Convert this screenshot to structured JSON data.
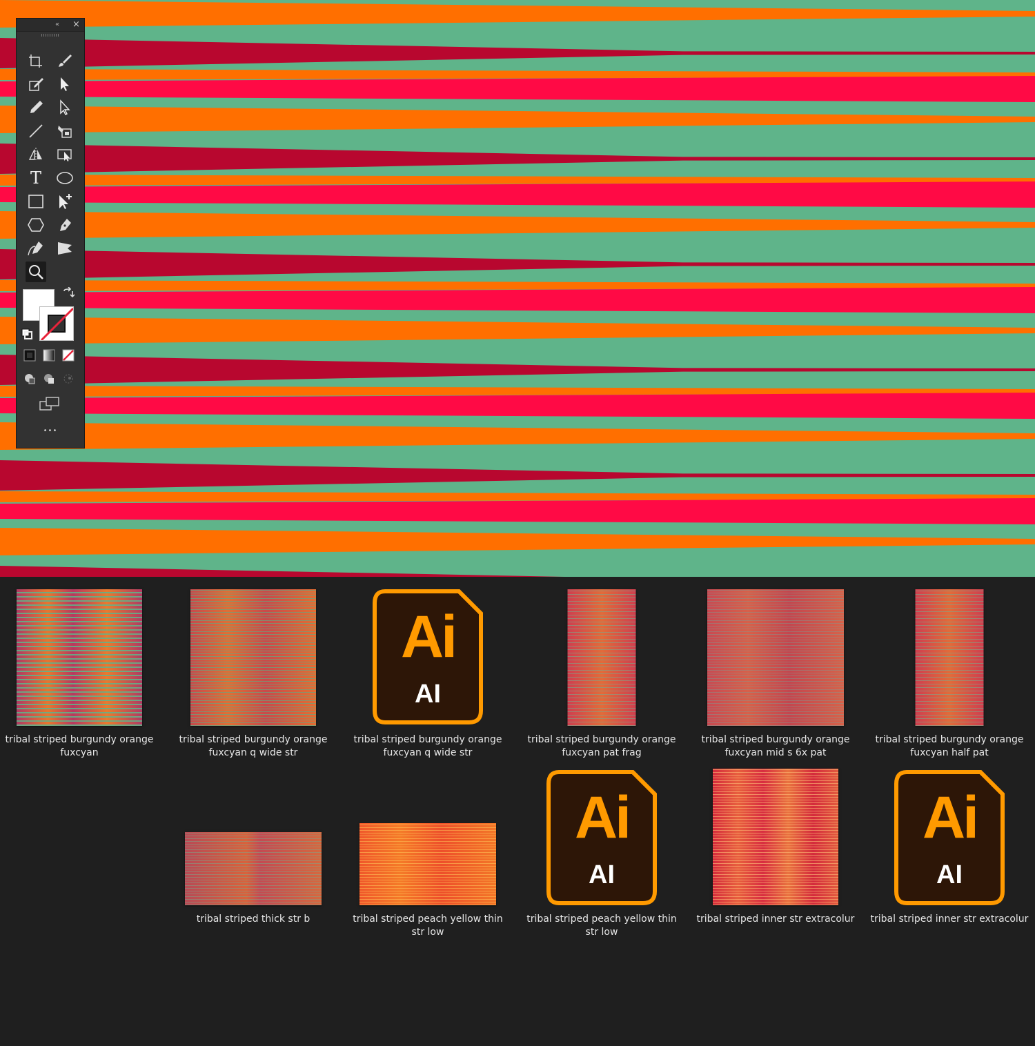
{
  "canvas": {
    "colors": {
      "background": "#5fb48a",
      "orange": "#ff6f00",
      "red": "#ff0a45",
      "burgundy": "#b8072f"
    }
  },
  "tools_panel": {
    "collapse_glyph": "«",
    "close_glyph": "×",
    "more_glyph": "•••",
    "text_tool_glyph": "T",
    "tools": [
      "artboard-tool-icon",
      "paintbrush-tool-icon",
      "pen-edit-tool-icon",
      "selection-tool-icon",
      "pencil-tool-icon",
      "direct-selection-tool-icon",
      "line-tool-icon",
      "live-paint-tool-icon",
      "reflect-tool-icon",
      "perspective-selection-tool-icon",
      "type-tool-icon",
      "ellipse-tool-icon",
      "rectangle-tool-icon",
      "add-anchor-tool-icon",
      "polygon-tool-icon",
      "pen-tool-icon",
      "curvature-tool-icon",
      "free-transform-tool-icon",
      "zoom-tool-icon"
    ]
  },
  "files": [
    {
      "name": "tribal striped burgundy orange fuxcyan",
      "type": "thumbnail"
    },
    {
      "name": "tribal striped burgundy orange fuxcyan q wide str",
      "type": "thumbnail"
    },
    {
      "name": "tribal striped burgundy orange fuxcyan q wide str",
      "type": "ai"
    },
    {
      "name": "tribal striped burgundy orange fuxcyan pat frag",
      "type": "thumbnail"
    },
    {
      "name": "tribal striped burgundy orange fuxcyan mid s 6x pat",
      "type": "thumbnail"
    },
    {
      "name": "tribal striped burgundy orange fuxcyan half pat",
      "type": "thumbnail"
    },
    {
      "name": "tribal striped thick str b",
      "type": "thumbnail"
    },
    {
      "name": "tribal striped peach yellow thin str low",
      "type": "thumbnail"
    },
    {
      "name": "tribal striped peach yellow thin str low",
      "type": "ai"
    },
    {
      "name": "tribal striped inner str extracolur",
      "type": "thumbnail"
    },
    {
      "name": "tribal striped inner str extracolur",
      "type": "ai"
    }
  ],
  "ai_icon": {
    "label_big": "Ai",
    "label_small": "AI",
    "accent": "#ff9a00",
    "fill": "#2d1607"
  }
}
